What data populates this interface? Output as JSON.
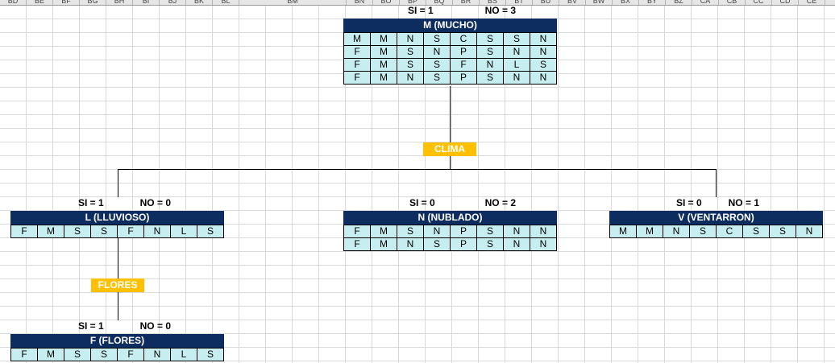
{
  "column_headers": [
    "BD",
    "BE",
    "BF",
    "BG",
    "BH",
    "BI",
    "BJ",
    "BK",
    "BL",
    "BM",
    "BN",
    "BO",
    "BP",
    "BQ",
    "BR",
    "BS",
    "BT",
    "BU",
    "BV",
    "BW",
    "BX",
    "BY",
    "BZ",
    "CA",
    "CB",
    "CC",
    "CD",
    "CE"
  ],
  "root": {
    "si": "SI = 1",
    "no": "NO = 3",
    "title": "M (MUCHO)",
    "rows": [
      [
        "M",
        "M",
        "N",
        "S",
        "C",
        "S",
        "S",
        "N"
      ],
      [
        "F",
        "M",
        "S",
        "N",
        "P",
        "S",
        "N",
        "N"
      ],
      [
        "F",
        "M",
        "S",
        "S",
        "F",
        "N",
        "L",
        "S"
      ],
      [
        "F",
        "M",
        "N",
        "S",
        "P",
        "S",
        "N",
        "N"
      ]
    ]
  },
  "split_labels": {
    "clima": "CLIMA",
    "flores": "FLORES"
  },
  "left": {
    "si": "SI = 1",
    "no": "NO = 0",
    "title": "L (LLUVIOSO)",
    "rows": [
      [
        "F",
        "M",
        "S",
        "S",
        "F",
        "N",
        "L",
        "S"
      ]
    ]
  },
  "middle": {
    "si": "SI = 0",
    "no": "NO = 2",
    "title": "N (NUBLADO)",
    "rows": [
      [
        "F",
        "M",
        "S",
        "N",
        "P",
        "S",
        "N",
        "N"
      ],
      [
        "F",
        "M",
        "N",
        "S",
        "P",
        "S",
        "N",
        "N"
      ]
    ]
  },
  "right": {
    "si": "SI = 0",
    "no": "NO = 1",
    "title": "V (VENTARRON)",
    "rows": [
      [
        "M",
        "M",
        "N",
        "S",
        "C",
        "S",
        "S",
        "N"
      ]
    ]
  },
  "leaf": {
    "si": "SI = 1",
    "no": "NO = 0",
    "title": "F (FLORES)",
    "rows": [
      [
        "F",
        "M",
        "S",
        "S",
        "F",
        "N",
        "L",
        "S"
      ]
    ]
  },
  "colors": {
    "title_bg": "#0d2c5f",
    "cell_bg": "#c6eef0",
    "badge_bg": "#ffc000",
    "grid": "#d9d9d9"
  }
}
